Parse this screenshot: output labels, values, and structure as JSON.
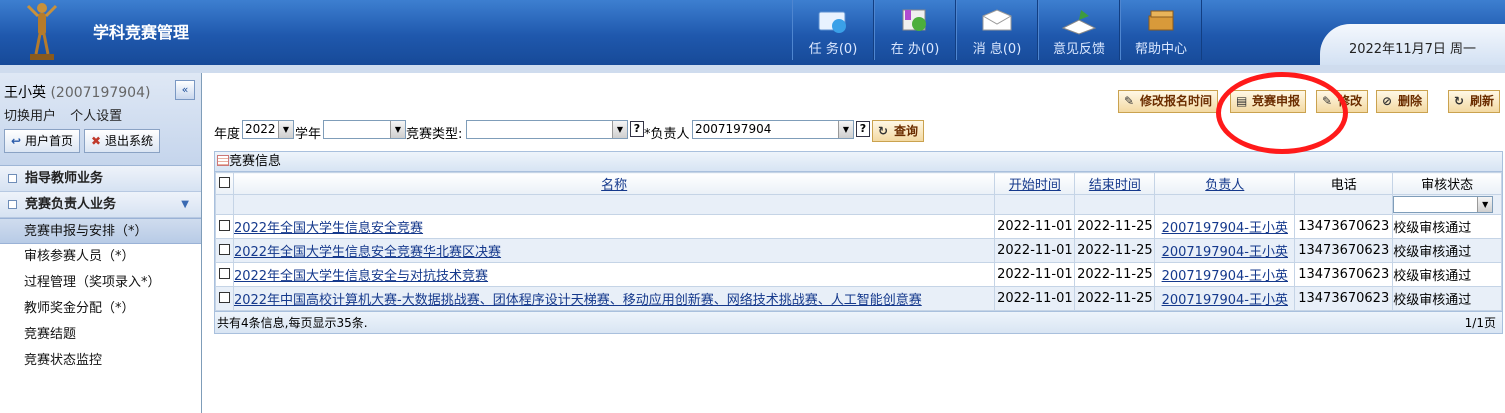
{
  "header": {
    "app_title": "学科竞赛管理",
    "nav": [
      {
        "label": "任 务(0)",
        "icon": "tasks-icon"
      },
      {
        "label": "在 办(0)",
        "icon": "in-progress-icon"
      },
      {
        "label": "消 息(0)",
        "icon": "messages-icon"
      },
      {
        "label": "意见反馈",
        "icon": "feedback-icon"
      },
      {
        "label": "帮助中心",
        "icon": "help-center-icon"
      }
    ],
    "date": "2022年11月7日 周一"
  },
  "user": {
    "name": "王小英",
    "id": "(2007197904)",
    "switch_user": "切换用户",
    "settings": "个人设置",
    "home_btn": "用户首页",
    "logout_btn": "退出系统"
  },
  "sidebar": {
    "groups": [
      {
        "label": "指导教师业务"
      },
      {
        "label": "竞赛负责人业务"
      }
    ],
    "items": [
      {
        "label": "竞赛申报与安排（*）"
      },
      {
        "label": "审核参赛人员（*）"
      },
      {
        "label": "过程管理（奖项录入*）"
      },
      {
        "label": "教师奖金分配（*）"
      },
      {
        "label": "竞赛结题"
      },
      {
        "label": "竞赛状态监控"
      }
    ]
  },
  "toolbar": {
    "edit_time": "修改报名时间",
    "declare": "竞赛申报",
    "edit": "修改",
    "delete": "删除",
    "refresh": "刷新"
  },
  "filter": {
    "year_label": "年度",
    "year_value": "2022",
    "term_label": "学年",
    "term_value": "",
    "type_label": "竞赛类型:",
    "type_value": "",
    "owner_label": "*负责人",
    "owner_value": "2007197904",
    "query_btn": "查询",
    "help": "?"
  },
  "grid": {
    "title": "竞赛信息",
    "columns": [
      "名称",
      "开始时间",
      "结束时间",
      "负责人",
      "电话",
      "审核状态"
    ],
    "rows": [
      {
        "name": "2022年全国大学生信息安全竞赛",
        "start": "2022-11-01",
        "end": "2022-11-25",
        "owner": "2007197904-王小英",
        "phone": "13473670623",
        "status": "校级审核通过"
      },
      {
        "name": "2022年全国大学生信息安全竞赛华北赛区决赛",
        "start": "2022-11-01",
        "end": "2022-11-25",
        "owner": "2007197904-王小英",
        "phone": "13473670623",
        "status": "校级审核通过"
      },
      {
        "name": "2022年全国大学生信息安全与对抗技术竞赛",
        "start": "2022-11-01",
        "end": "2022-11-25",
        "owner": "2007197904-王小英",
        "phone": "13473670623",
        "status": "校级审核通过"
      },
      {
        "name": "2022年中国高校计算机大赛-大数据挑战赛、团体程序设计天梯赛、移动应用创新赛、网络技术挑战赛、人工智能创意赛",
        "start": "2022-11-01",
        "end": "2022-11-25",
        "owner": "2007197904-王小英",
        "phone": "13473670623",
        "status": "校级审核通过"
      }
    ],
    "footer": "共有4条信息,每页显示35条.",
    "page": "1/1页"
  },
  "colors": {
    "header_blue": "#1f58ad",
    "annotation_red": "#ff1a1a",
    "button_gold": "#f3d9a2"
  }
}
